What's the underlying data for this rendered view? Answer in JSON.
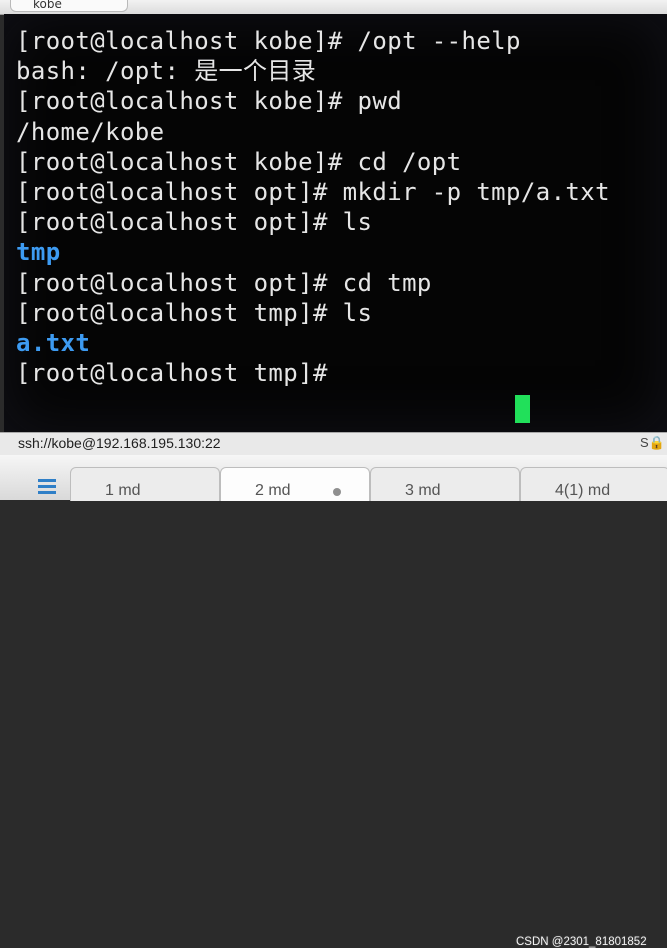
{
  "window": {
    "top_tab_label": "kobe"
  },
  "terminal": {
    "lines": [
      {
        "text": "[root@localhost kobe]# /opt --help",
        "type": "prompt"
      },
      {
        "text": "bash: /opt: 是一个目录",
        "type": "output"
      },
      {
        "text": "[root@localhost kobe]# pwd",
        "type": "prompt"
      },
      {
        "text": "/home/kobe",
        "type": "output"
      },
      {
        "text": "[root@localhost kobe]# cd /opt",
        "type": "prompt"
      },
      {
        "text": "[root@localhost opt]# mkdir -p tmp/a.txt",
        "type": "prompt"
      },
      {
        "text": "[root@localhost opt]# ls",
        "type": "prompt"
      },
      {
        "text": "tmp",
        "type": "directory"
      },
      {
        "text": "[root@localhost opt]# cd tmp",
        "type": "prompt"
      },
      {
        "text": "[root@localhost tmp]# ls",
        "type": "prompt"
      },
      {
        "text": "a.txt",
        "type": "directory"
      },
      {
        "text": "[root@localhost tmp]#",
        "type": "prompt"
      }
    ],
    "colors": {
      "text": "#e6e6e6",
      "directory": "#3d9bf2",
      "cursor": "#21e05a",
      "background": "#050505"
    }
  },
  "status_bar": {
    "connection": "ssh://kobe@192.168.195.130:22",
    "lock_icon": "lock-icon"
  },
  "session_tabs": [
    {
      "label": "1 md",
      "active": false
    },
    {
      "label": "2 md",
      "active": true
    },
    {
      "label": "3 md",
      "active": false
    },
    {
      "label": "4(1) md",
      "active": false
    }
  ],
  "watermark": "CSDN @2301_81801852"
}
